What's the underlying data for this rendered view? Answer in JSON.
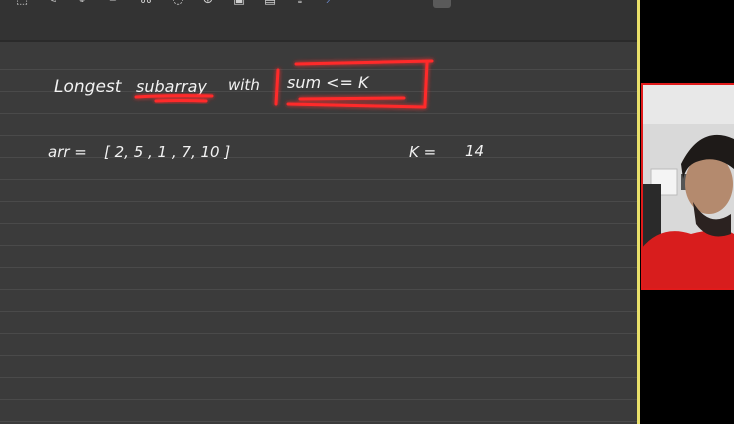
{
  "toolbar": {
    "tools": [
      {
        "name": "select-tool",
        "glyph": "⬚"
      },
      {
        "name": "pen-tool",
        "glyph": "✎"
      },
      {
        "name": "highlighter-tool",
        "glyph": "✐"
      },
      {
        "name": "marker-tool",
        "glyph": "✏"
      },
      {
        "name": "lasso-tool",
        "glyph": "⌘"
      },
      {
        "name": "eraser-tool",
        "glyph": "◌"
      },
      {
        "name": "shape-tool",
        "glyph": "⊕"
      },
      {
        "name": "image-tool",
        "glyph": "▣"
      },
      {
        "name": "text-box-tool",
        "glyph": "▤"
      },
      {
        "name": "upload-tool",
        "glyph": "⇪"
      },
      {
        "name": "ruler-tool",
        "glyph": "⟋"
      }
    ]
  },
  "whiteboard": {
    "title_word_1": "Longest",
    "title_word_2": "subarray",
    "title_word_3": "with",
    "title_condition": "sum <= K",
    "array_label": "arr =",
    "array_values": "[ 2,  5 ,  1 ,  7,   10 ]",
    "k_label": "K =",
    "k_value": "14"
  },
  "colors": {
    "board_bg": "#3b3b3b",
    "ink": "#f2f2f2",
    "highlight_red": "#ff2a2a",
    "seam": "#e9e06a"
  }
}
